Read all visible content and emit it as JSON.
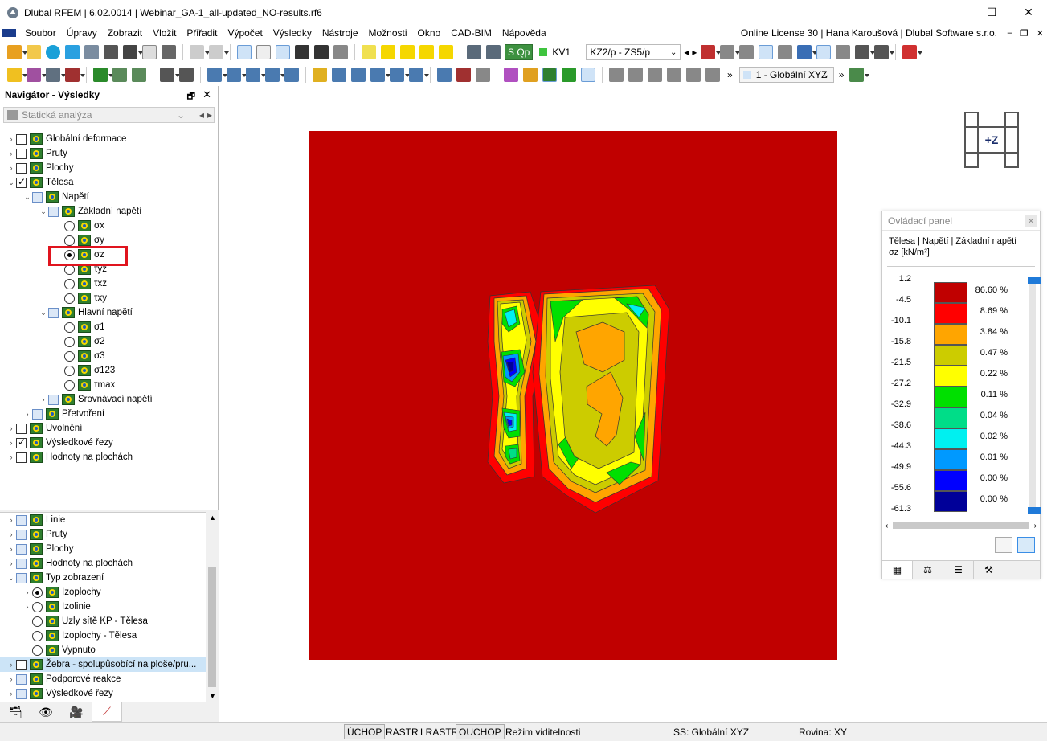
{
  "window": {
    "title": "Dlubal RFEM | 6.02.0014 | Webinar_GA-1_all-updated_NO-results.rf6",
    "minimize": "—",
    "maximize": "☐",
    "close": "✕"
  },
  "menu": {
    "items": [
      "Soubor",
      "Úpravy",
      "Zobrazit",
      "Vložit",
      "Přiřadit",
      "Výpočet",
      "Výsledky",
      "Nástroje",
      "Možnosti",
      "Okno",
      "CAD-BIM",
      "Nápověda"
    ],
    "license": "Online License 30 | Hana Karoušová | Dlubal Software s.r.o."
  },
  "toolbar": {
    "load_case_badge": "S Qp",
    "load_case_code": "KV1",
    "load_case_name": "KZ2/p - ZS5/p",
    "coord_system": "1 - Globální XYZ"
  },
  "navigator": {
    "title": "Navigátor - Výsledky",
    "analysis_combo": "Statická analýza",
    "top_tree": [
      {
        "label": "Globální deformace",
        "level": 0,
        "expander": "›",
        "ctrl": "chk",
        "state": "off"
      },
      {
        "label": "Pruty",
        "level": 0,
        "expander": "›",
        "ctrl": "chk",
        "state": "off"
      },
      {
        "label": "Plochy",
        "level": 0,
        "expander": "›",
        "ctrl": "chk",
        "state": "off"
      },
      {
        "label": "Tělesa",
        "level": 0,
        "expander": "⌄",
        "ctrl": "chk",
        "state": "on"
      },
      {
        "label": "Napětí",
        "level": 1,
        "expander": "⌄",
        "ctrl": "chk",
        "state": "part"
      },
      {
        "label": "Základní napětí",
        "level": 2,
        "expander": "⌄",
        "ctrl": "chk",
        "state": "part"
      },
      {
        "label": "σx",
        "level": 3,
        "expander": "",
        "ctrl": "rad",
        "state": "off"
      },
      {
        "label": "σy",
        "level": 3,
        "expander": "",
        "ctrl": "rad",
        "state": "off"
      },
      {
        "label": "σz",
        "level": 3,
        "expander": "",
        "ctrl": "rad",
        "state": "on"
      },
      {
        "label": "τyz",
        "level": 3,
        "expander": "",
        "ctrl": "rad",
        "state": "off"
      },
      {
        "label": "τxz",
        "level": 3,
        "expander": "",
        "ctrl": "rad",
        "state": "off"
      },
      {
        "label": "τxy",
        "level": 3,
        "expander": "",
        "ctrl": "rad",
        "state": "off"
      },
      {
        "label": "Hlavní napětí",
        "level": 2,
        "expander": "⌄",
        "ctrl": "chk",
        "state": "part"
      },
      {
        "label": "σ1",
        "level": 3,
        "expander": "",
        "ctrl": "rad",
        "state": "off"
      },
      {
        "label": "σ2",
        "level": 3,
        "expander": "",
        "ctrl": "rad",
        "state": "off"
      },
      {
        "label": "σ3",
        "level": 3,
        "expander": "",
        "ctrl": "rad",
        "state": "off"
      },
      {
        "label": "σ123",
        "level": 3,
        "expander": "",
        "ctrl": "rad",
        "state": "off"
      },
      {
        "label": "τmax",
        "level": 3,
        "expander": "",
        "ctrl": "rad",
        "state": "off"
      },
      {
        "label": "Srovnávací napětí",
        "level": 2,
        "expander": "›",
        "ctrl": "chk",
        "state": "part"
      },
      {
        "label": "Přetvoření",
        "level": 1,
        "expander": "›",
        "ctrl": "chk",
        "state": "part"
      },
      {
        "label": "Uvolnění",
        "level": 0,
        "expander": "›",
        "ctrl": "chk",
        "state": "off"
      },
      {
        "label": "Výsledkové řezy",
        "level": 0,
        "expander": "›",
        "ctrl": "chk",
        "state": "on"
      },
      {
        "label": "Hodnoty na plochách",
        "level": 0,
        "expander": "›",
        "ctrl": "chk",
        "state": "off"
      }
    ],
    "bottom_tree": [
      {
        "label": "Linie",
        "level": 0,
        "expander": "›",
        "ctrl": "chk",
        "state": "part"
      },
      {
        "label": "Pruty",
        "level": 0,
        "expander": "›",
        "ctrl": "chk",
        "state": "part"
      },
      {
        "label": "Plochy",
        "level": 0,
        "expander": "›",
        "ctrl": "chk",
        "state": "part"
      },
      {
        "label": "Hodnoty na plochách",
        "level": 0,
        "expander": "›",
        "ctrl": "chk",
        "state": "part"
      },
      {
        "label": "Typ zobrazení",
        "level": 0,
        "expander": "⌄",
        "ctrl": "chk",
        "state": "part"
      },
      {
        "label": "Izoplochy",
        "level": 1,
        "expander": "›",
        "ctrl": "rad",
        "state": "on"
      },
      {
        "label": "Izolinie",
        "level": 1,
        "expander": "›",
        "ctrl": "rad",
        "state": "off"
      },
      {
        "label": "Uzly sítě KP - Tělesa",
        "level": 1,
        "expander": "",
        "ctrl": "rad",
        "state": "off"
      },
      {
        "label": "Izoplochy - Tělesa",
        "level": 1,
        "expander": "",
        "ctrl": "rad",
        "state": "off"
      },
      {
        "label": "Vypnuto",
        "level": 1,
        "expander": "",
        "ctrl": "rad",
        "state": "off"
      },
      {
        "label": "Žebra - spolupůsobící na ploše/pru...",
        "level": 0,
        "expander": "›",
        "ctrl": "chk",
        "state": "off"
      },
      {
        "label": "Podporové reakce",
        "level": 0,
        "expander": "›",
        "ctrl": "chk",
        "state": "part"
      },
      {
        "label": "Výsledkové řezy",
        "level": 0,
        "expander": "›",
        "ctrl": "chk",
        "state": "part"
      }
    ]
  },
  "view": {
    "cube_label": "+Z"
  },
  "control_panel": {
    "title": "Ovládací panel",
    "heading": "Tělesa | Napětí | Základní napětí",
    "unit": "σz [kN/m²]",
    "legend": [
      {
        "value": "1.2",
        "color": "#c00000",
        "percent": "86.60 %"
      },
      {
        "value": "-4.5",
        "color": "#ff0000",
        "percent": "8.69 %"
      },
      {
        "value": "-10.1",
        "color": "#ffa500",
        "percent": "3.84 %"
      },
      {
        "value": "-15.8",
        "color": "#cccc00",
        "percent": "0.47 %"
      },
      {
        "value": "-21.5",
        "color": "#ffff00",
        "percent": "0.22 %"
      },
      {
        "value": "-27.2",
        "color": "#00e000",
        "percent": "0.11 %"
      },
      {
        "value": "-32.9",
        "color": "#00dd88",
        "percent": "0.04 %"
      },
      {
        "value": "-38.6",
        "color": "#00f0f0",
        "percent": "0.02 %"
      },
      {
        "value": "-44.3",
        "color": "#0099ff",
        "percent": "0.01 %"
      },
      {
        "value": "-49.9",
        "color": "#0000ff",
        "percent": "0.00 %"
      },
      {
        "value": "-55.6",
        "color": "#000099",
        "percent": "0.00 %"
      },
      {
        "value": "-61.3",
        "color": "",
        "percent": ""
      }
    ]
  },
  "statusbar": {
    "uchop": "ÚCHOP",
    "rastr": "RASTR",
    "lrastr": "LRASTR",
    "ouchop": "OUCHOP",
    "visibility": "Režim viditelnosti",
    "ss": "SS: Globální XYZ",
    "plane": "Rovina: XY"
  }
}
